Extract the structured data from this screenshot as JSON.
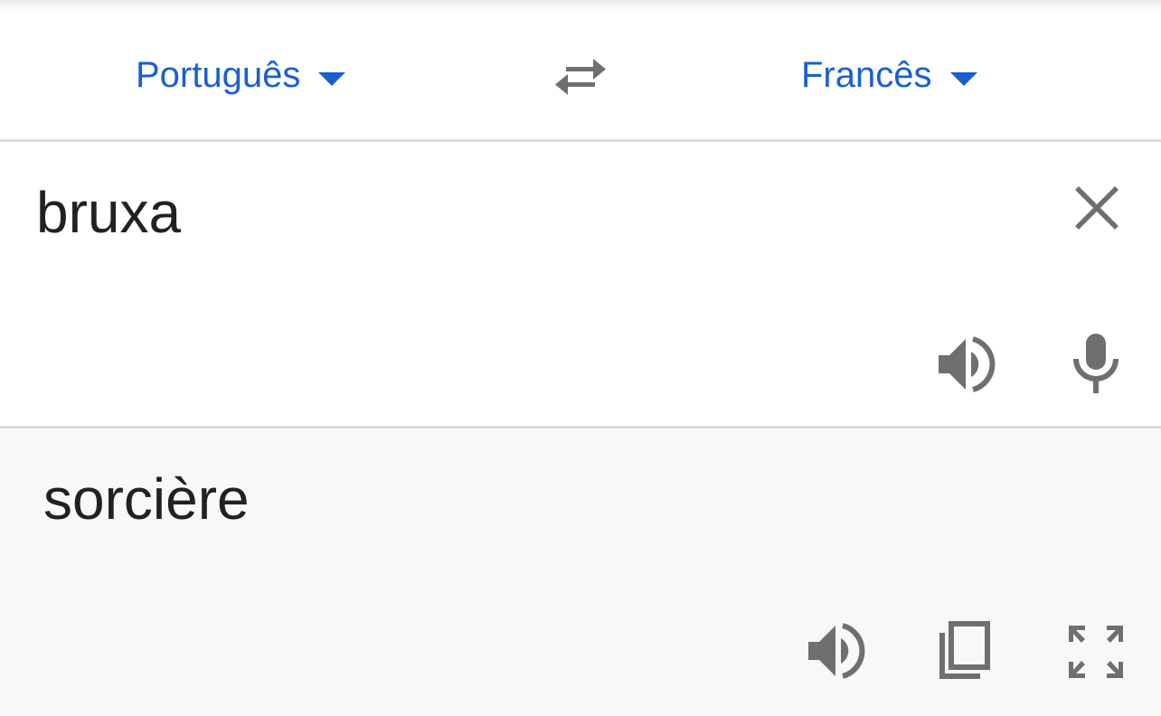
{
  "languages": {
    "source": "Português",
    "target": "Francês"
  },
  "source": {
    "text": "bruxa"
  },
  "result": {
    "text": "sorcière"
  },
  "icons": {
    "swap": "swap-arrows-icon",
    "clear": "close-icon",
    "source_listen": "speaker-icon",
    "mic": "microphone-icon",
    "result_listen": "speaker-icon",
    "copy": "copy-icon",
    "fullscreen": "fullscreen-icon"
  },
  "colors": {
    "accent": "#1a5fd1",
    "icon": "#6f6f6f",
    "text": "#202124",
    "result_bg": "#f8f8f8",
    "divider": "#dcdcdc"
  }
}
